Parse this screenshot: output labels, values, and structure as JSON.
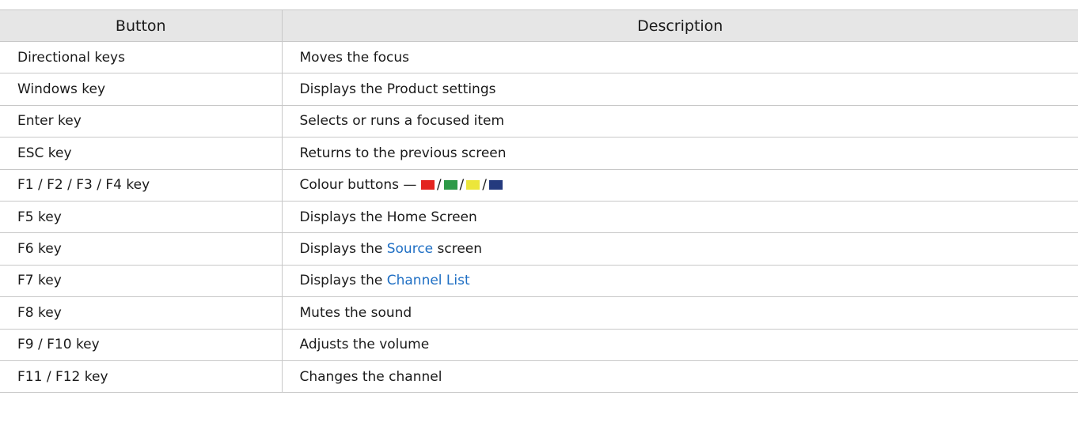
{
  "table": {
    "headers": [
      "Button",
      "Description"
    ],
    "rows": [
      {
        "button": "Directional keys",
        "pre": "Moves the focus",
        "link": "",
        "post": ""
      },
      {
        "button": "Windows key",
        "pre": "Displays the Product settings",
        "link": "",
        "post": ""
      },
      {
        "button": "Enter key",
        "pre": "Selects or runs a focused item",
        "link": "",
        "post": ""
      },
      {
        "button": "ESC key",
        "pre": "Returns to the previous screen",
        "link": "",
        "post": ""
      },
      {
        "button": "F1 / F2 / F3 / F4 key",
        "pre": "Colour buttons — ",
        "link": "",
        "post": ""
      },
      {
        "button": "F5 key",
        "pre": "Displays the Home Screen",
        "link": "",
        "post": ""
      },
      {
        "button": "F6 key",
        "pre": "Displays the ",
        "link": "Source",
        "post": " screen"
      },
      {
        "button": "F7 key",
        "pre": "Displays the ",
        "link": "Channel List",
        "post": ""
      },
      {
        "button": "F8 key",
        "pre": "Mutes the sound",
        "link": "",
        "post": ""
      },
      {
        "button": "F9 / F10 key",
        "pre": "Adjusts the volume",
        "link": "",
        "post": ""
      },
      {
        "button": "F11 / F12 key",
        "pre": "Changes the channel",
        "link": "",
        "post": ""
      }
    ],
    "colour_buttons": {
      "separator": "/",
      "swatches": [
        "#e4231f",
        "#2e9a48",
        "#ece63a",
        "#243a7e"
      ]
    }
  }
}
